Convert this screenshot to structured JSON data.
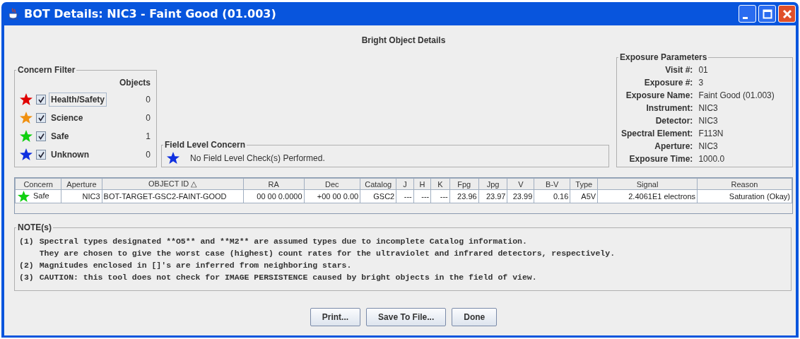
{
  "window": {
    "title": "BOT Details: NIC3 - Faint Good (01.003)"
  },
  "heading": "Bright Object Details",
  "concern_filter": {
    "title": "Concern Filter",
    "count_header": "Objects",
    "items": [
      {
        "label": "Health/Safety",
        "color": "#e00000",
        "checked": true,
        "focused": true,
        "count": "0"
      },
      {
        "label": "Science",
        "color": "#f09010",
        "checked": true,
        "focused": false,
        "count": "0"
      },
      {
        "label": "Safe",
        "color": "#10d010",
        "checked": true,
        "focused": false,
        "count": "1"
      },
      {
        "label": "Unknown",
        "color": "#1030e0",
        "checked": true,
        "focused": false,
        "count": "0"
      }
    ]
  },
  "field_level_concern": {
    "title": "Field Level Concern",
    "color": "#1030e0",
    "message": "No Field Level Check(s) Performed."
  },
  "exposure_parameters": {
    "title": "Exposure Parameters",
    "rows": [
      {
        "label": "Visit #:",
        "value": "01"
      },
      {
        "label": "Exposure #:",
        "value": "3"
      },
      {
        "label": "Exposure Name:",
        "value": "Faint Good (01.003)"
      },
      {
        "label": "Instrument:",
        "value": "NIC3"
      },
      {
        "label": "Detector:",
        "value": "NIC3"
      },
      {
        "label": "Spectral Element:",
        "value": "F113N"
      },
      {
        "label": "Aperture:",
        "value": "NIC3"
      },
      {
        "label": "Exposure Time:",
        "value": "1000.0"
      }
    ]
  },
  "table": {
    "columns": [
      "Concern",
      "Aperture",
      "OBJECT ID △",
      "RA",
      "Dec",
      "Catalog",
      "J",
      "H",
      "K",
      "Fpg",
      "Jpg",
      "V",
      "B-V",
      "Type",
      "Signal",
      "Reason"
    ],
    "rows": [
      {
        "color": "#10d010",
        "cells": [
          "Safe",
          "NIC3",
          "BOT-TARGET-GSC2-FAINT-GOOD",
          "00 00 0.0000",
          "+00 00 0.00",
          "GSC2",
          "---",
          "---",
          "---",
          "23.96",
          "23.97",
          "23.99",
          "0.16",
          "A5V",
          "2.4061E1 electrons",
          "Saturation (Okay)"
        ]
      }
    ]
  },
  "notes": {
    "title": "NOTE(s)",
    "items": [
      {
        "number": "(1)",
        "lines": [
          "Spectral types designated **O5** and **M2** are assumed types due to incomplete Catalog information.",
          "They are chosen to give the worst case (highest) count rates for the ultraviolet and infrared detectors, respectively."
        ]
      },
      {
        "number": "(2)",
        "lines": [
          "Magnitudes enclosed in []'s are inferred from neighboring stars."
        ]
      },
      {
        "number": "(3)",
        "lines": [
          "CAUTION: this tool does not check for IMAGE PERSISTENCE caused by bright objects in the field of view."
        ]
      }
    ]
  },
  "buttons": [
    "Print...",
    "Save To File...",
    "Done"
  ]
}
